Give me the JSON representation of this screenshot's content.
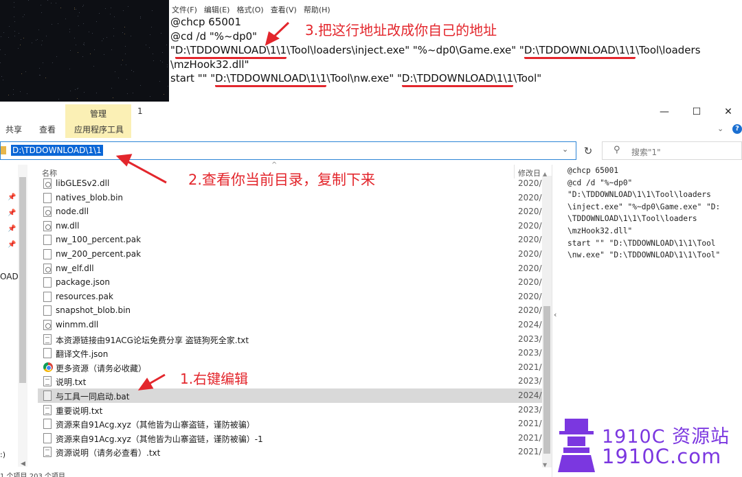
{
  "notepad": {
    "menu": [
      "文件(F)",
      "编辑(E)",
      "格式(O)",
      "查看(V)",
      "帮助(H)"
    ],
    "line1": "@chcp 65001",
    "line2": "@cd /d \"%~dp0\"",
    "line3_a": "\"",
    "line3_path1": "D:\\TDDOWNLOAD\\1\\1",
    "line3_b": "\\Tool\\loaders\\inject.exe\" \"%~dp0\\Game.exe\" \"",
    "line3_path2": "D:\\TDDOWNLOAD\\1\\1",
    "line3_c": "\\Tool\\loaders",
    "line4": "\\mzHook32.dll\"",
    "line5_a": "start \"\" \"",
    "line5_path1": "D:\\TDDOWNLOAD\\1\\1",
    "line5_b": "\\Tool\\nw.exe\" \"",
    "line5_path2": "D:\\TDDOWNLOAD\\1\\1",
    "line5_c": "\\Tool\""
  },
  "annotations": {
    "step3": "3.把这行地址改成你自己的地址",
    "step2": "2.查看你当前目录，复制下来",
    "step1": "1.右键编辑",
    "color": "#e3262c"
  },
  "explorer": {
    "window_title": "1",
    "tab_manage": "管理",
    "tab_share": "共享",
    "tab_view": "查看",
    "tab_app_tools": "应用程序工具",
    "win_minimize": "—",
    "win_maximize": "☐",
    "win_close": "✕",
    "address": "D:\\TDDOWNLOAD\\1\\1",
    "search_placeholder": "搜索\"1\"",
    "col_name": "名称",
    "col_date": "修改日",
    "nav_label": "OAD",
    "nav_drive": ":)",
    "status": "1 个项目  203 个项目",
    "files": [
      {
        "name": "libGLESv2.dll",
        "date": "2020/",
        "icon": "gear"
      },
      {
        "name": "natives_blob.bin",
        "date": "2020/",
        "icon": "file"
      },
      {
        "name": "node.dll",
        "date": "2020/",
        "icon": "gear"
      },
      {
        "name": "nw.dll",
        "date": "2020/",
        "icon": "gear"
      },
      {
        "name": "nw_100_percent.pak",
        "date": "2020/",
        "icon": "file"
      },
      {
        "name": "nw_200_percent.pak",
        "date": "2020/",
        "icon": "file"
      },
      {
        "name": "nw_elf.dll",
        "date": "2020/",
        "icon": "gear"
      },
      {
        "name": "package.json",
        "date": "2020/",
        "icon": "file"
      },
      {
        "name": "resources.pak",
        "date": "2020/",
        "icon": "file"
      },
      {
        "name": "snapshot_blob.bin",
        "date": "2020/",
        "icon": "file"
      },
      {
        "name": "winmm.dll",
        "date": "2024/",
        "icon": "gear"
      },
      {
        "name": "本资源链接由91ACG论坛免费分享 盗链狗死全家.txt",
        "date": "2023/",
        "icon": "txt"
      },
      {
        "name": "翻译文件.json",
        "date": "2023/",
        "icon": "file"
      },
      {
        "name": "更多资源（请务必收藏）",
        "date": "2021/",
        "icon": "chrome"
      },
      {
        "name": "说明.txt",
        "date": "2023/",
        "icon": "txt"
      },
      {
        "name": "与工具一同启动.bat",
        "date": "2024/",
        "icon": "bat",
        "selected": true
      },
      {
        "name": "重要说明.txt",
        "date": "2023/",
        "icon": "txt"
      },
      {
        "name": "资源来自91Acg.xyz（其他皆为山寨盗链，谨防被骗）",
        "date": "2021/",
        "icon": "file"
      },
      {
        "name": "资源来自91Acg.xyz（其他皆为山寨盗链，谨防被骗）-1",
        "date": "2021/",
        "icon": "file"
      },
      {
        "name": "资源说明（请务必查看）.txt",
        "date": "2021/",
        "icon": "txt"
      }
    ]
  },
  "preview": {
    "lines": [
      "@chcp 65001",
      "@cd /d \"%~dp0\"",
      "\"D:\\TDDOWNLOAD\\1\\1\\Tool\\loaders",
      "\\inject.exe\" \"%~dp0\\Game.exe\" \"D:",
      "\\TDDOWNLOAD\\1\\1\\Tool\\loaders",
      "\\mzHook32.dll\"",
      "start \"\" \"D:\\TDDOWNLOAD\\1\\1\\Tool",
      "\\nw.exe\" \"D:\\TDDOWNLOAD\\1\\1\\Tool\""
    ]
  },
  "watermark": {
    "line1": "1910C 资源站",
    "line2": "1910C.com",
    "color": "#7b37e0"
  }
}
